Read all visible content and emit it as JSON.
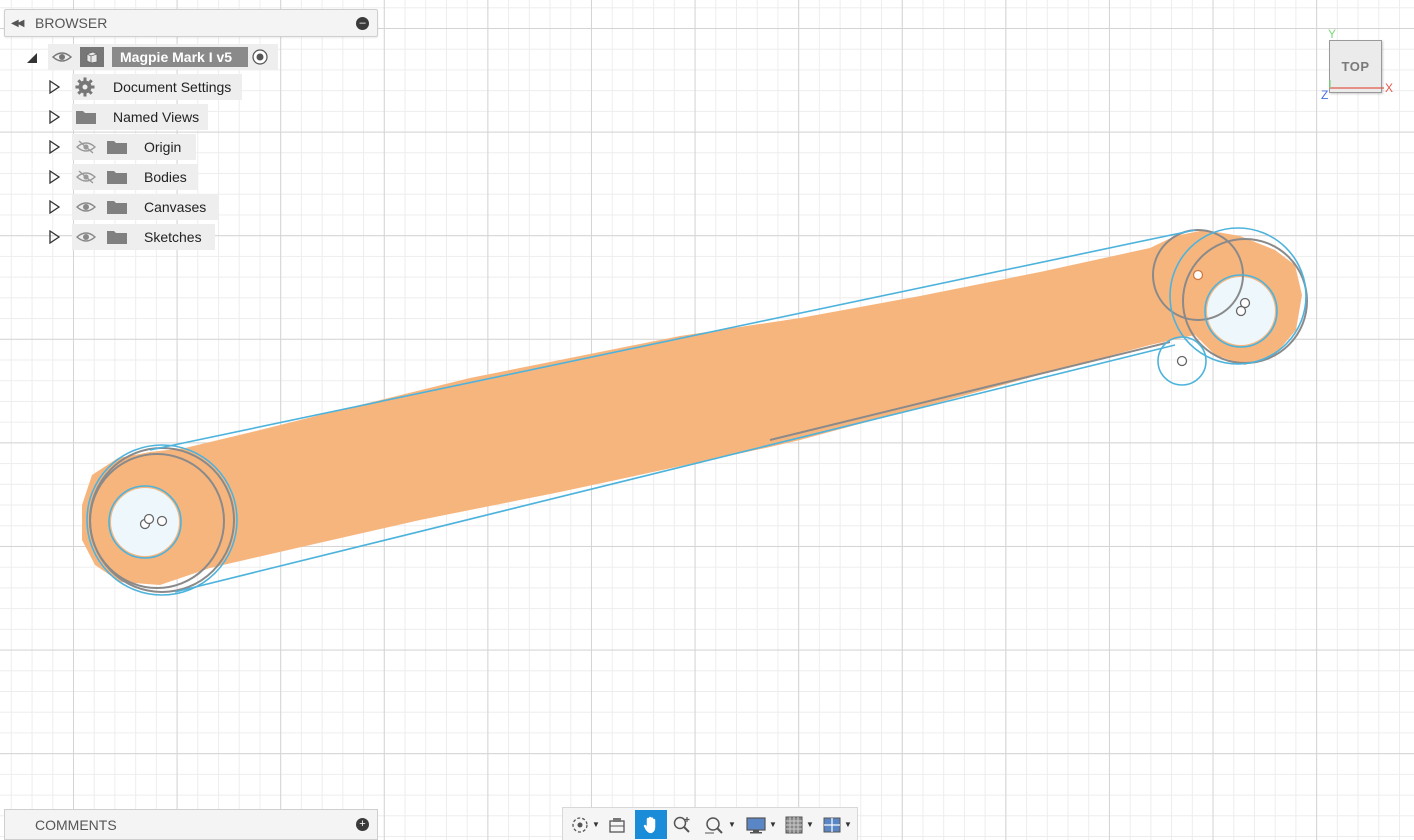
{
  "browser": {
    "title": "BROWSER",
    "collapse_icon": "double-chevron-left-icon",
    "toggle_icon": "minus-circle-icon",
    "root": {
      "label": "Magpie Mark I v5",
      "visible": true,
      "icon": "component-icon",
      "activate_icon": "radio-target-icon"
    },
    "items": [
      {
        "label": "Document Settings",
        "icon": "gear-icon",
        "visibility": "none"
      },
      {
        "label": "Named Views",
        "icon": "folder-icon",
        "visibility": "none"
      },
      {
        "label": "Origin",
        "icon": "folder-icon",
        "visibility": "hidden"
      },
      {
        "label": "Bodies",
        "icon": "folder-icon",
        "visibility": "hidden"
      },
      {
        "label": "Canvases",
        "icon": "folder-icon",
        "visibility": "visible"
      },
      {
        "label": "Sketches",
        "icon": "folder-icon",
        "visibility": "visible"
      }
    ]
  },
  "comments": {
    "title": "COMMENTS",
    "toggle_icon": "plus-circle-icon"
  },
  "viewcube": {
    "face": "TOP",
    "axes": {
      "x": "X",
      "y": "Y",
      "z": "Z"
    },
    "colors": {
      "x": "#e05a4a",
      "y": "#7ad67a",
      "z": "#4a6fe0"
    }
  },
  "toolbar": {
    "buttons": [
      {
        "name": "orbit",
        "icon": "orbit-icon",
        "has_menu": true,
        "active": false
      },
      {
        "name": "look-at",
        "icon": "look-at-icon",
        "has_menu": false,
        "active": false
      },
      {
        "name": "pan",
        "icon": "hand-pan-icon",
        "has_menu": false,
        "active": true
      },
      {
        "name": "zoom",
        "icon": "zoom-icon",
        "has_menu": false,
        "active": false
      },
      {
        "name": "fit",
        "icon": "zoom-window-icon",
        "has_menu": true,
        "active": false
      },
      {
        "name": "display-settings",
        "icon": "monitor-icon",
        "has_menu": true,
        "active": false
      },
      {
        "name": "grid-snaps",
        "icon": "grid-icon",
        "has_menu": true,
        "active": false
      },
      {
        "name": "viewports",
        "icon": "viewports-icon",
        "has_menu": true,
        "active": false
      }
    ]
  },
  "colors": {
    "canvas_fill": "#f7b57e",
    "sketch_line": "#4db3dc",
    "body_edge": "#8a8a8a",
    "active_tool": "#1a8cd8"
  }
}
